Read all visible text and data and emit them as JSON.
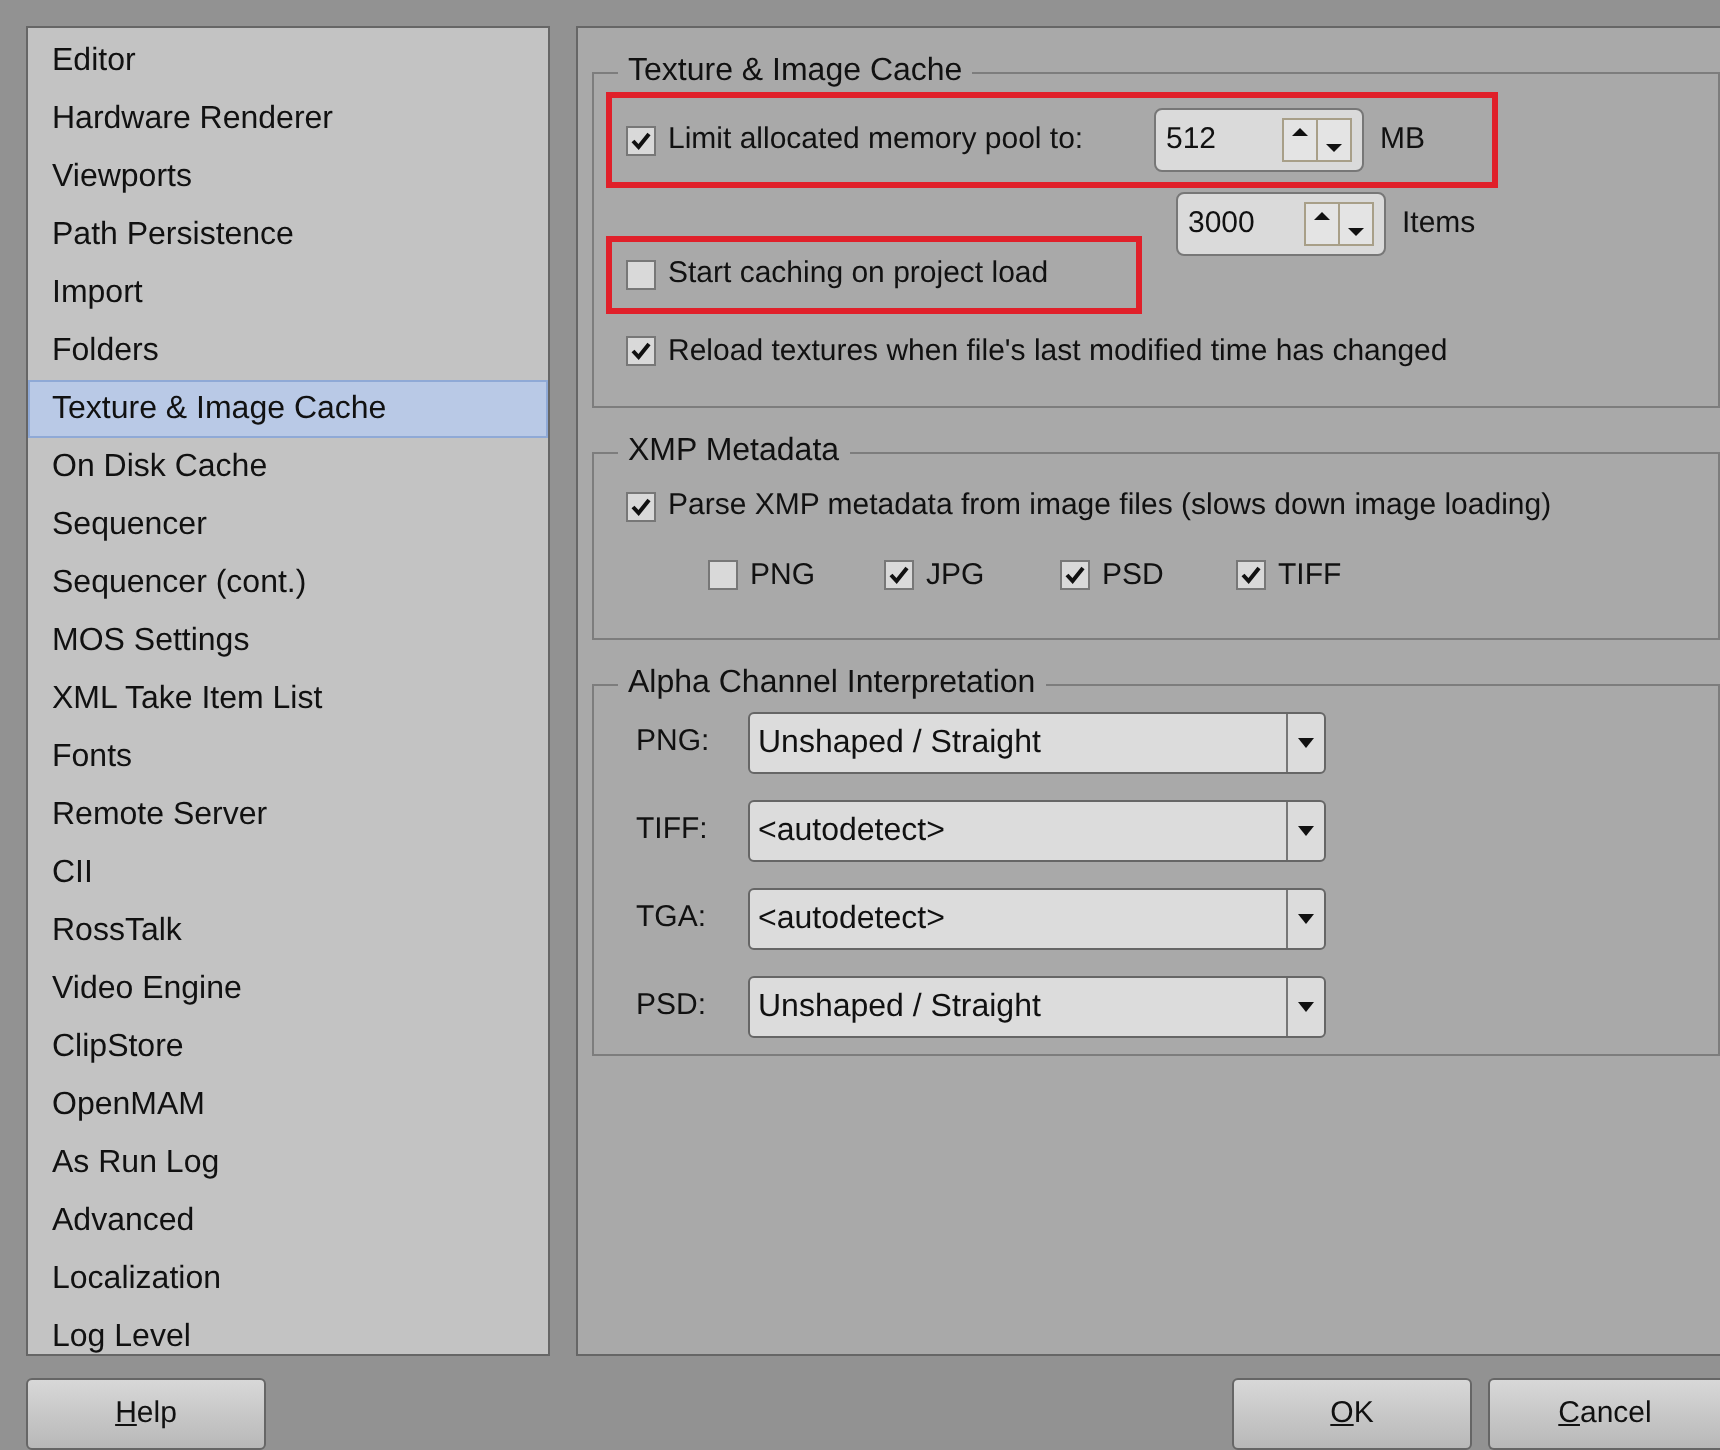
{
  "sidebar": {
    "items": [
      {
        "label": "Editor",
        "selected": false
      },
      {
        "label": "Hardware Renderer",
        "selected": false
      },
      {
        "label": "Viewports",
        "selected": false
      },
      {
        "label": "Path Persistence",
        "selected": false
      },
      {
        "label": "Import",
        "selected": false
      },
      {
        "label": "Folders",
        "selected": false
      },
      {
        "label": "Texture & Image Cache",
        "selected": true
      },
      {
        "label": "On Disk Cache",
        "selected": false
      },
      {
        "label": "Sequencer",
        "selected": false
      },
      {
        "label": "Sequencer (cont.)",
        "selected": false
      },
      {
        "label": "MOS Settings",
        "selected": false
      },
      {
        "label": "XML Take Item List",
        "selected": false
      },
      {
        "label": "Fonts",
        "selected": false
      },
      {
        "label": "Remote Server",
        "selected": false
      },
      {
        "label": "CII",
        "selected": false
      },
      {
        "label": "RossTalk",
        "selected": false
      },
      {
        "label": "Video Engine",
        "selected": false
      },
      {
        "label": "ClipStore",
        "selected": false
      },
      {
        "label": "OpenMAM",
        "selected": false
      },
      {
        "label": "As Run Log",
        "selected": false
      },
      {
        "label": "Advanced",
        "selected": false
      },
      {
        "label": "Localization",
        "selected": false
      },
      {
        "label": "Log Level",
        "selected": false
      }
    ]
  },
  "texture_cache": {
    "title": "Texture & Image Cache",
    "limit": {
      "label": "Limit allocated memory pool to:",
      "checked": true,
      "highlighted": true,
      "value": "512",
      "unit": "MB"
    },
    "items_limit": {
      "value": "3000",
      "unit": "Items"
    },
    "start_caching": {
      "label": "Start caching on project load",
      "checked": false,
      "highlighted": true
    },
    "reload": {
      "label": "Reload textures when file's last modified time has changed",
      "checked": true,
      "highlighted": false
    }
  },
  "xmp": {
    "title": "XMP Metadata",
    "parse": {
      "label": "Parse XMP metadata from image files (slows down image loading)",
      "checked": true
    },
    "formats": [
      {
        "label": "PNG",
        "checked": false
      },
      {
        "label": "JPG",
        "checked": true
      },
      {
        "label": "PSD",
        "checked": true
      },
      {
        "label": "TIFF",
        "checked": true
      }
    ]
  },
  "alpha": {
    "title": "Alpha Channel Interpretation",
    "rows": [
      {
        "label": "PNG:",
        "value": "Unshaped / Straight"
      },
      {
        "label": "TIFF:",
        "value": "<autodetect>"
      },
      {
        "label": "TGA:",
        "value": "<autodetect>"
      },
      {
        "label": "PSD:",
        "value": "Unshaped / Straight"
      }
    ]
  },
  "buttons": {
    "help": "Help",
    "ok": "OK",
    "cancel": "Cancel"
  }
}
